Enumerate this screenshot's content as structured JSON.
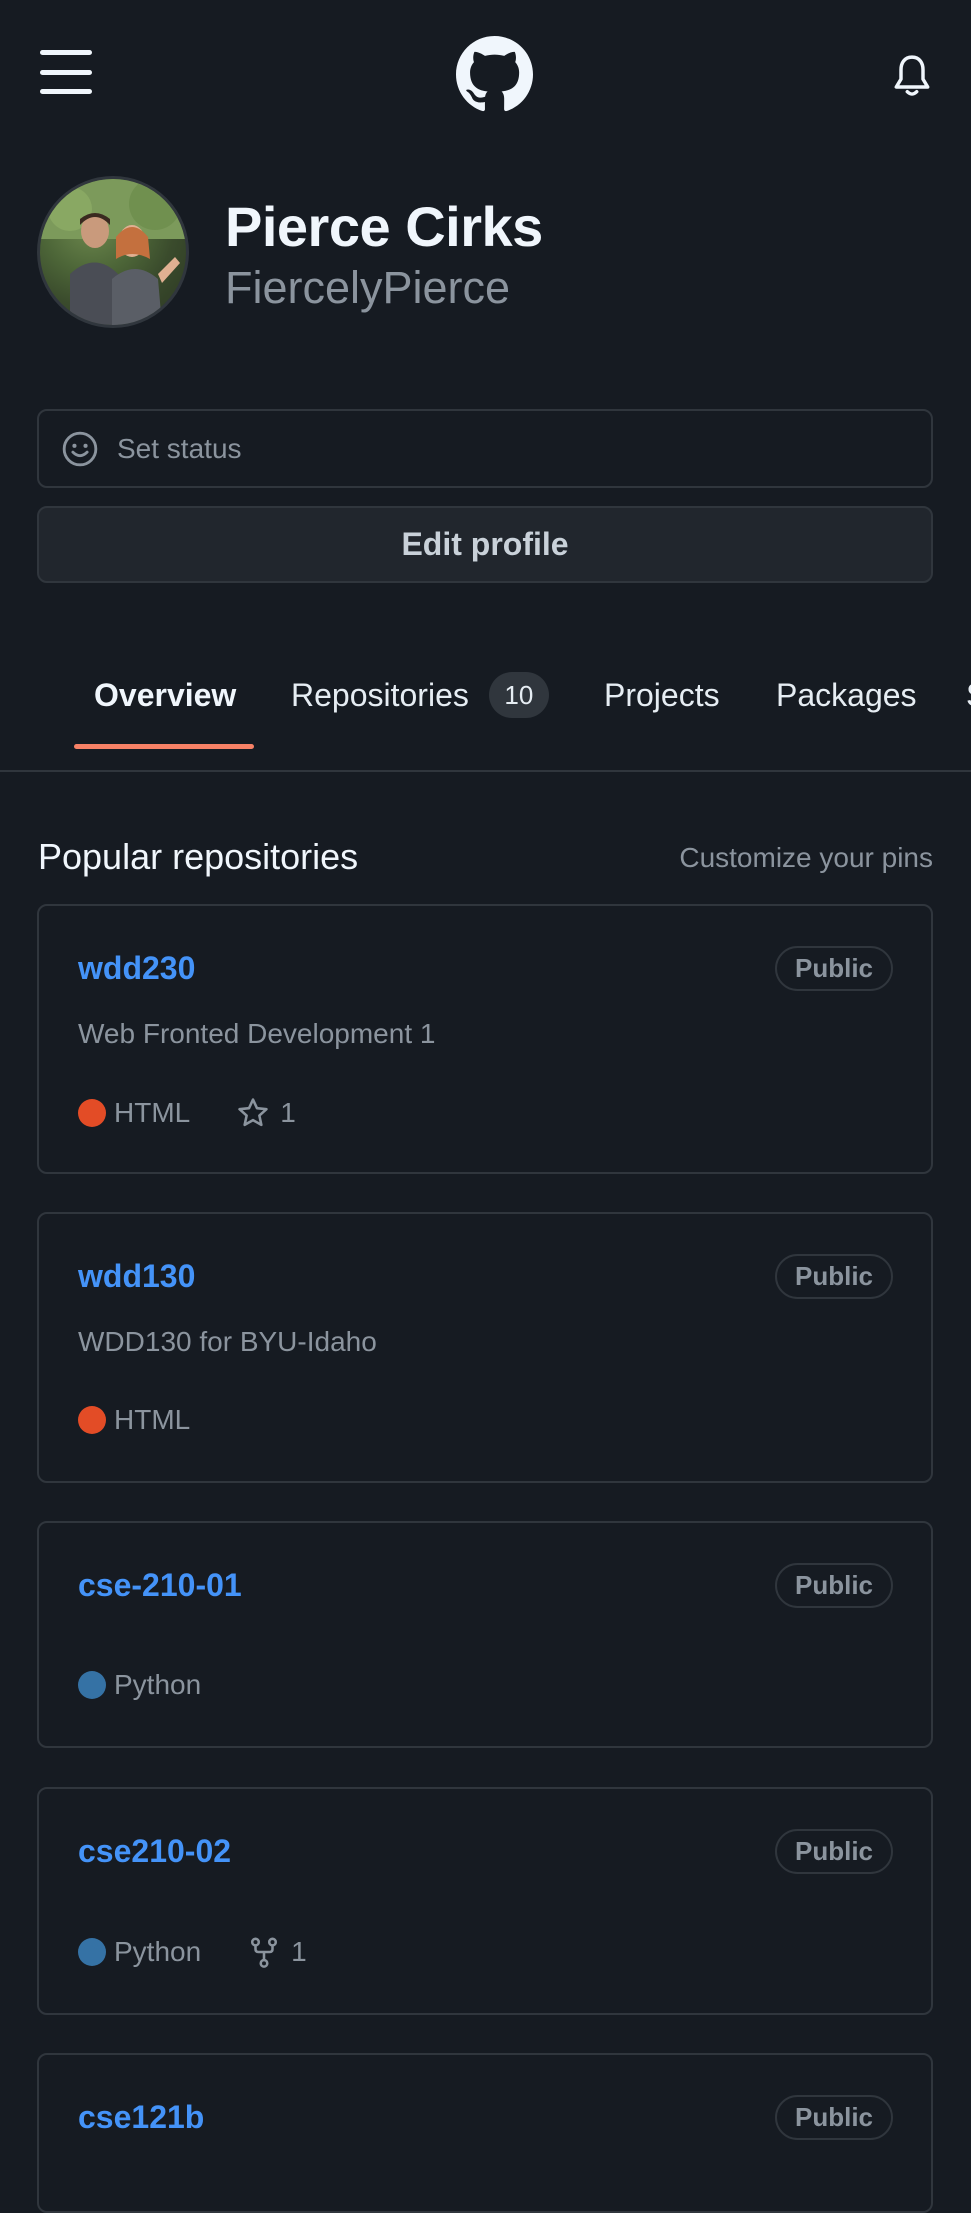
{
  "header": {
    "menu_icon": "hamburger-icon",
    "logo_icon": "github-logo-icon",
    "notifications_icon": "bell-icon"
  },
  "profile": {
    "name": "Pierce Cirks",
    "login": "FiercelyPierce",
    "set_status": "Set status",
    "edit_profile": "Edit profile"
  },
  "tabs": [
    {
      "label": "Overview"
    },
    {
      "label": "Repositories",
      "count": "10"
    },
    {
      "label": "Projects"
    },
    {
      "label": "Packages"
    },
    {
      "label": "S"
    }
  ],
  "popular": {
    "title": "Popular repositories",
    "customize": "Customize your pins"
  },
  "repos": [
    {
      "name": "wdd230",
      "visibility": "Public",
      "description": "Web Fronted Development 1",
      "language": "HTML",
      "lang_color": "#e34c26",
      "stars": "1"
    },
    {
      "name": "wdd130",
      "visibility": "Public",
      "description": "WDD130 for BYU-Idaho",
      "language": "HTML",
      "lang_color": "#e34c26"
    },
    {
      "name": "cse-210-01",
      "visibility": "Public",
      "language": "Python",
      "lang_color": "#3572A5"
    },
    {
      "name": "cse210-02",
      "visibility": "Public",
      "language": "Python",
      "lang_color": "#3572A5",
      "forks": "1"
    },
    {
      "name": "cse121b",
      "visibility": "Public"
    }
  ],
  "colors": {
    "background": "#161b22",
    "border": "#30363d",
    "link": "#4493f8",
    "tab_underline": "#f78166"
  }
}
